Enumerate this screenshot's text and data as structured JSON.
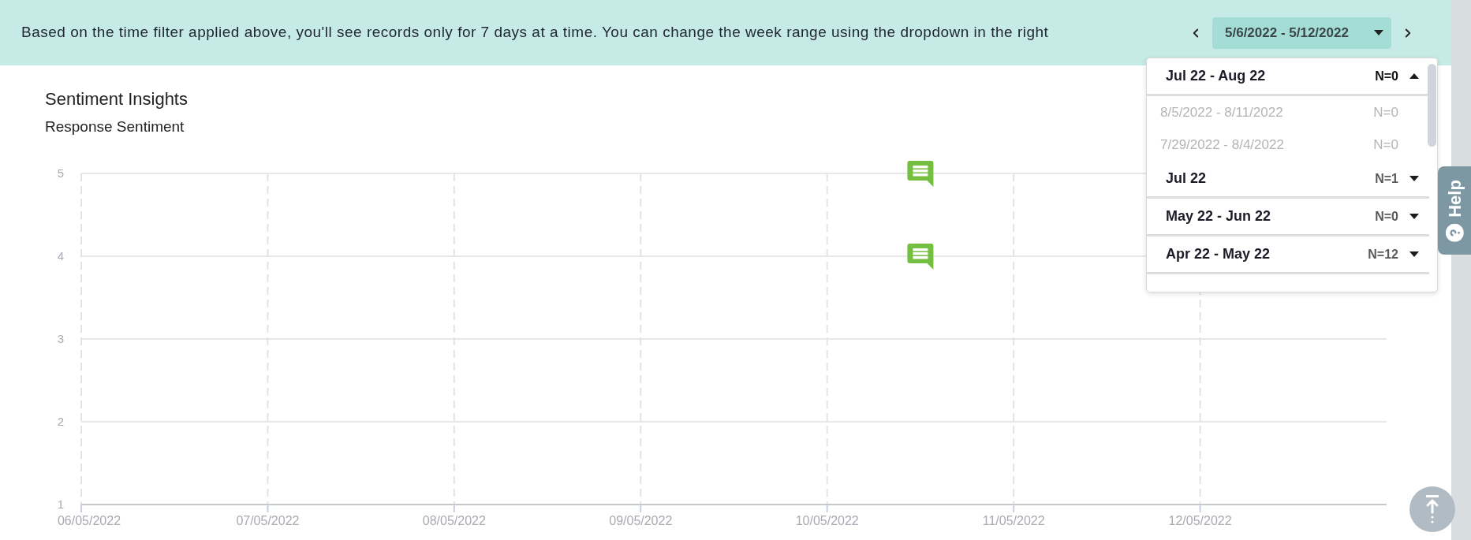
{
  "banner": {
    "message": "Based on the time filter applied above, you'll see records only for 7 days at a time. You can change the week range using the dropdown in the right",
    "week_range": "5/6/2022 - 5/12/2022"
  },
  "section": {
    "title": "Sentiment Insights",
    "subtitle": "Response Sentiment",
    "chart_data": {
      "type": "scatter",
      "categories": [
        "06/05/2022",
        null,
        "07/05/2022",
        null,
        "08/05/2022",
        null,
        "09/05/2022",
        null,
        "10/05/2022",
        null,
        "11/05/2022",
        null,
        "12/05/2022",
        null
      ],
      "series": [
        {
          "color": "#74bf3f",
          "values": [
            null,
            null,
            null,
            null,
            null,
            null,
            null,
            null,
            null,
            5,
            null,
            null,
            null,
            null
          ]
        },
        {
          "color": "#74bf3f",
          "values": [
            null,
            null,
            null,
            null,
            null,
            null,
            null,
            null,
            null,
            4,
            null,
            null,
            null,
            null
          ]
        }
      ],
      "ylim": [
        1,
        5
      ],
      "yticks": [
        1,
        2,
        3,
        4,
        5
      ],
      "grid": true
    }
  },
  "week_dropdown": {
    "groups": [
      {
        "label": "Jul 22 - Aug 22",
        "count": "N=0",
        "expanded": true,
        "children": [
          {
            "label": "8/5/2022 - 8/11/2022",
            "count": "N=0",
            "disabled": true
          },
          {
            "label": "7/29/2022 - 8/4/2022",
            "count": "N=0",
            "disabled": true
          }
        ]
      },
      {
        "label": "Jul 22",
        "count": "N=1",
        "expanded": false
      },
      {
        "label": "May 22 - Jun 22",
        "count": "N=0",
        "expanded": false
      },
      {
        "label": "Apr 22 - May 22",
        "count": "N=12",
        "expanded": false
      }
    ]
  },
  "help_tab": {
    "label": "Help"
  }
}
